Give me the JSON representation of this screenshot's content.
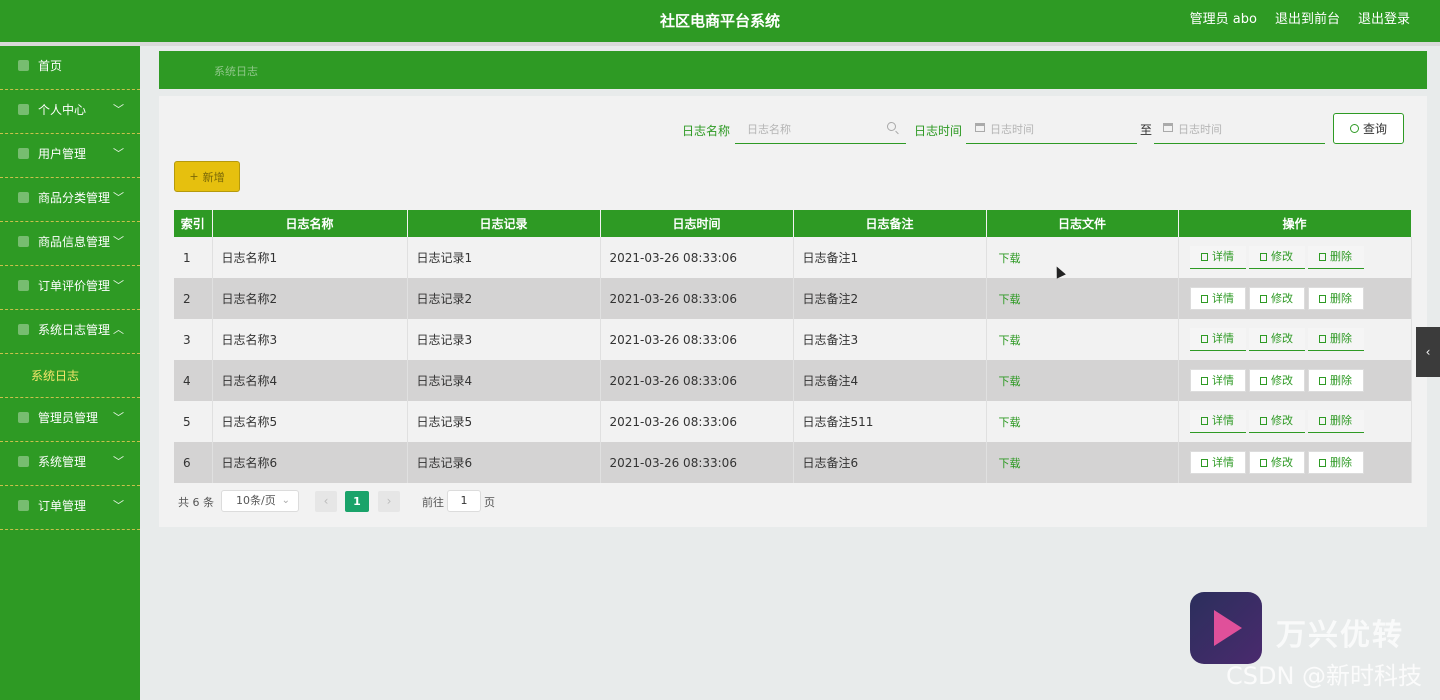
{
  "header": {
    "title": "社区电商平台系统",
    "user": "管理员 abo",
    "to_front": "退出到前台",
    "logout": "退出登录"
  },
  "sidebar": {
    "items": [
      {
        "label": "首页",
        "icon": "home-icon",
        "chevron": ""
      },
      {
        "label": "个人中心",
        "icon": "user-icon",
        "chevron": "﹀"
      },
      {
        "label": "用户管理",
        "icon": "users-icon",
        "chevron": "﹀"
      },
      {
        "label": "商品分类管理",
        "icon": "category-icon",
        "chevron": "﹀"
      },
      {
        "label": "商品信息管理",
        "icon": "goods-icon",
        "chevron": "﹀"
      },
      {
        "label": "订单评价管理",
        "icon": "comment-icon",
        "chevron": "﹀"
      },
      {
        "label": "系统日志管理",
        "icon": "log-icon",
        "chevron": "︿"
      },
      {
        "label": "管理员管理",
        "icon": "admin-icon",
        "chevron": "﹀"
      },
      {
        "label": "系统管理",
        "icon": "settings-icon",
        "chevron": "﹀"
      },
      {
        "label": "订单管理",
        "icon": "order-icon",
        "chevron": "﹀"
      }
    ],
    "sub_item": "系统日志"
  },
  "breadcrumb": "系统日志",
  "search": {
    "name_label": "日志名称",
    "name_placeholder": "日志名称",
    "time_label": "日志时间",
    "time_start_placeholder": "日志时间",
    "to": "至",
    "time_end_placeholder": "日志时间",
    "query_button": "查询"
  },
  "add_button": "新增",
  "table": {
    "headers": [
      "索引",
      "日志名称",
      "日志记录",
      "日志时间",
      "日志备注",
      "日志文件",
      "操作"
    ],
    "rows": [
      {
        "index": "1",
        "name": "日志名称1",
        "record": "日志记录1",
        "time": "2021-03-26 08:33:06",
        "remark": "日志备注1",
        "file": "下载"
      },
      {
        "index": "2",
        "name": "日志名称2",
        "record": "日志记录2",
        "time": "2021-03-26 08:33:06",
        "remark": "日志备注2",
        "file": "下载"
      },
      {
        "index": "3",
        "name": "日志名称3",
        "record": "日志记录3",
        "time": "2021-03-26 08:33:06",
        "remark": "日志备注3",
        "file": "下载"
      },
      {
        "index": "4",
        "name": "日志名称4",
        "record": "日志记录4",
        "time": "2021-03-26 08:33:06",
        "remark": "日志备注4",
        "file": "下载"
      },
      {
        "index": "5",
        "name": "日志名称5",
        "record": "日志记录5",
        "time": "2021-03-26 08:33:06",
        "remark": "日志备注511",
        "file": "下载"
      },
      {
        "index": "6",
        "name": "日志名称6",
        "record": "日志记录6",
        "time": "2021-03-26 08:33:06",
        "remark": "日志备注6",
        "file": "下载"
      }
    ],
    "actions": {
      "detail": "详情",
      "edit": "修改",
      "delete": "删除"
    }
  },
  "pager": {
    "total": "共 6 条",
    "page_size": "10条/页",
    "prev": "‹",
    "current": "1",
    "next": "›",
    "goto": "前往",
    "goto_value": "1",
    "page_label": "页"
  },
  "side_tab": "‹",
  "watermark": {
    "brand": "万兴优转",
    "csdn": "CSDN @新时科技"
  },
  "colors": {
    "primary": "#2e9a24",
    "add_button": "#e6c00e",
    "active_page": "#1aa36a"
  }
}
